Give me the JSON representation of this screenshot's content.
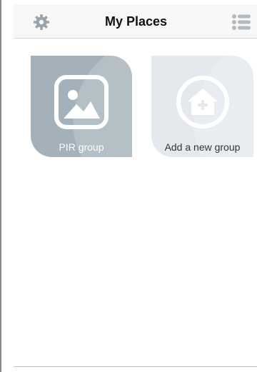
{
  "header": {
    "title": "My Places",
    "settings_icon": "gear-icon",
    "menu_icon": "list-menu-icon"
  },
  "groups": [
    {
      "label": "PIR group",
      "icon": "image-icon",
      "color": "#a5b1ba"
    },
    {
      "label": "Add a new group",
      "icon": "house-plus-icon",
      "color": "#e5e9ee"
    }
  ],
  "colors": {
    "header_bg": "#f7f7f7",
    "icon_gray": "#9aa3aa",
    "menu_gray": "#b3b9bf"
  }
}
